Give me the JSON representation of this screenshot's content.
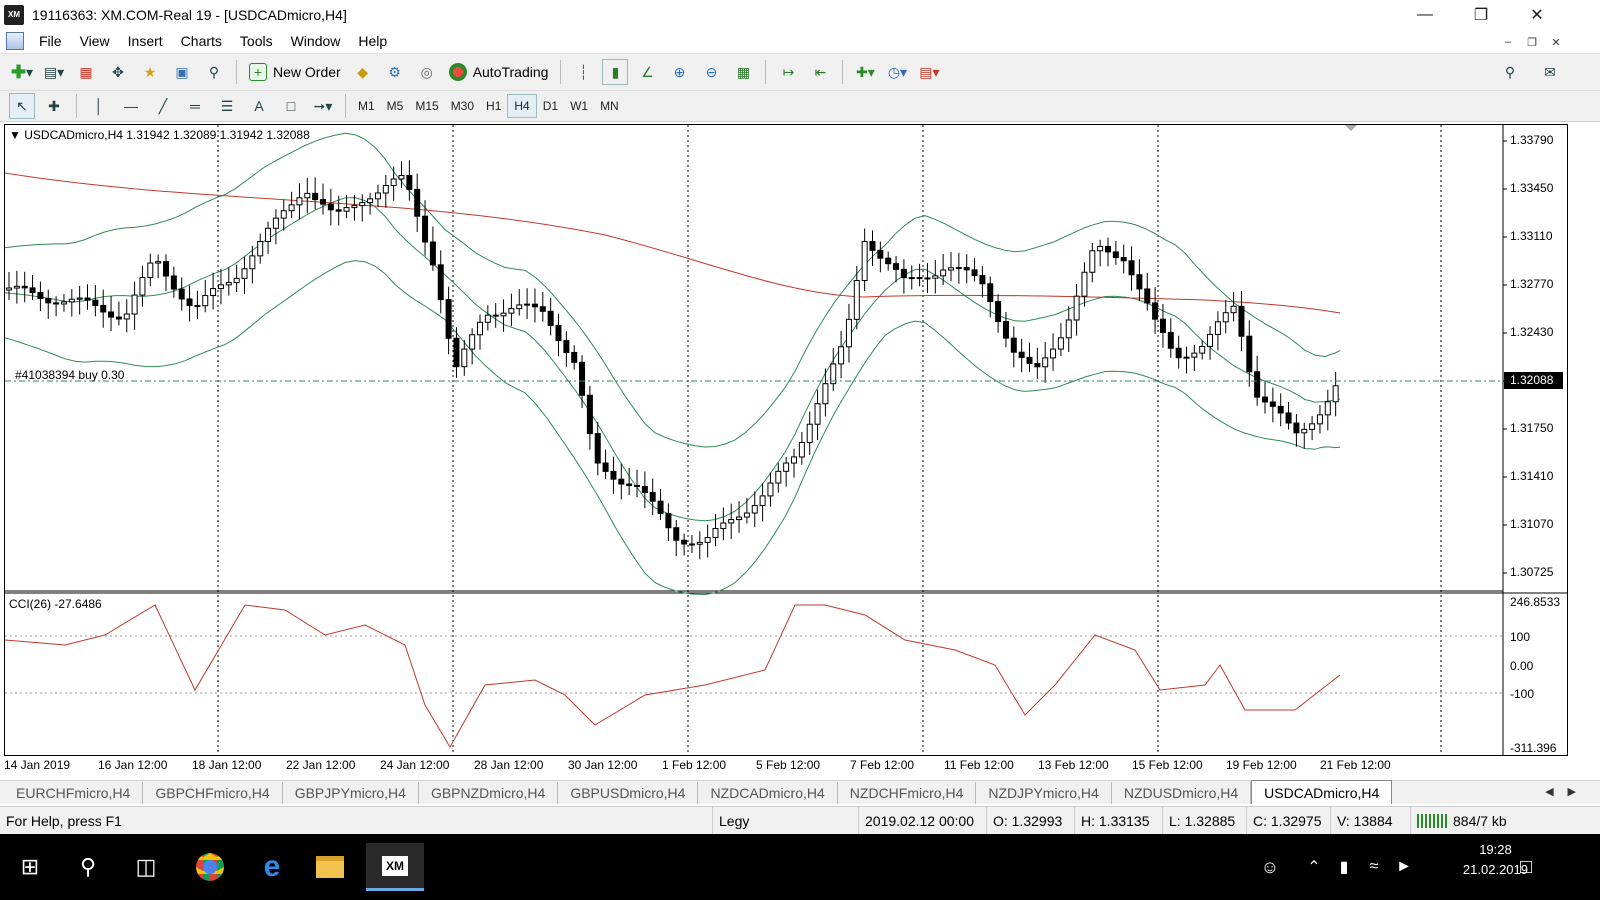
{
  "window": {
    "title": "19116363: XM.COM-Real 19 - [USDCADmicro,H4]",
    "logo": "XM"
  },
  "menu": [
    "File",
    "View",
    "Insert",
    "Charts",
    "Tools",
    "Window",
    "Help"
  ],
  "toolbar": {
    "new_order": "New Order",
    "auto_trading": "AutoTrading"
  },
  "timeframes": [
    "M1",
    "M5",
    "M15",
    "M30",
    "H1",
    "H4",
    "D1",
    "W1",
    "MN"
  ],
  "active_timeframe": "H4",
  "chart": {
    "header": "USDCADmicro,H4  1.31942 1.32089 1.31942 1.32088",
    "order_label": "#41038394 buy 0.30",
    "price_scale": [
      "1.33790",
      "1.33450",
      "1.33110",
      "1.32770",
      "1.32430",
      "1.32088",
      "1.31750",
      "1.31410",
      "1.31070",
      "1.30725"
    ],
    "current_price": "1.32088",
    "indicator_header": "CCI(26) -27.6486",
    "cci_scale": [
      "246.8533",
      "100",
      "0.00",
      "-100",
      "-311.396"
    ],
    "dates": [
      "14 Jan 2019",
      "16 Jan 12:00",
      "18 Jan 12:00",
      "22 Jan 12:00",
      "24 Jan 12:00",
      "28 Jan 12:00",
      "30 Jan 12:00",
      "1 Feb 12:00",
      "5 Feb 12:00",
      "7 Feb 12:00",
      "11 Feb 12:00",
      "13 Feb 12:00",
      "15 Feb 12:00",
      "19 Feb 12:00",
      "21 Feb 12:00"
    ]
  },
  "tabs": [
    "EURCHFmicro,H4",
    "GBPCHFmicro,H4",
    "GBPJPYmicro,H4",
    "GBPNZDmicro,H4",
    "GBPUSDmicro,H4",
    "NZDCADmicro,H4",
    "NZDCHFmicro,H4",
    "NZDJPYmicro,H4",
    "NZDUSDmicro,H4",
    "USDCADmicro,H4"
  ],
  "active_tab": "USDCADmicro,H4",
  "status": {
    "help": "For Help, press F1",
    "profile": "Legy",
    "time": "2019.02.12 00:00",
    "open": "O: 1.32993",
    "high": "H: 1.33135",
    "low": "L: 1.32885",
    "close": "C: 1.32975",
    "volume": "V: 13884",
    "traffic": "884/7 kb"
  },
  "taskbar": {
    "time": "19:28",
    "date": "21.02.2019"
  }
}
